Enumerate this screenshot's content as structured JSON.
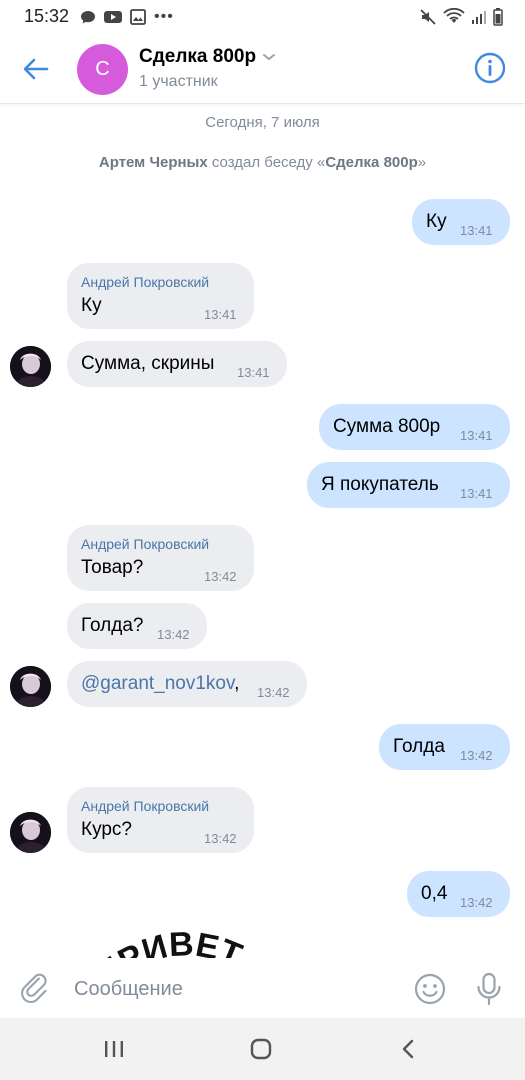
{
  "status_bar": {
    "time": "15:32",
    "left_icons": [
      "chat-bubble-icon",
      "youtube-icon",
      "image-icon",
      "more-dots-icon"
    ],
    "right_icons": [
      "mute-icon",
      "wifi-icon",
      "signal-icon",
      "battery-icon"
    ],
    "dots": "•••"
  },
  "header": {
    "avatar_letter": "С",
    "avatar_color": "#d65bdc",
    "title": "Сделка 800р",
    "subtitle": "1 участник"
  },
  "chat": {
    "date_separator": "Сегодня, 7 июля",
    "system_message": {
      "author": "Артем Черных",
      "action": " создал беседу «",
      "chat_name": "Сделка 800р",
      "closing": "»"
    },
    "messages": [
      {
        "dir": "out",
        "text": "Ку",
        "time": "13:41"
      },
      {
        "dir": "in",
        "author": "Андрей Покровский",
        "text": "Ку",
        "time": "13:41"
      },
      {
        "dir": "in",
        "text": "Сумма, скрины",
        "time": "13:41"
      },
      {
        "dir": "out",
        "text": "Сумма 800р",
        "time": "13:41"
      },
      {
        "dir": "out",
        "text": "Я покупатель",
        "time": "13:41"
      },
      {
        "dir": "in",
        "author": "Андрей Покровский",
        "text": "Товар?",
        "time": "13:42"
      },
      {
        "dir": "in",
        "text": "Голда?",
        "time": "13:42"
      },
      {
        "dir": "in",
        "text": "@garant_nov1kov",
        "text_suffix": ",",
        "time": "13:42"
      },
      {
        "dir": "out",
        "text": "Голда",
        "time": "13:42"
      },
      {
        "dir": "in",
        "author": "Андрей Покровский",
        "text": "Курс?",
        "time": "13:42"
      },
      {
        "dir": "out",
        "text": "0,4",
        "time": "13:42"
      }
    ],
    "sticker_partial_text": "ПРИВЕТ"
  },
  "composer": {
    "placeholder": "Сообщение"
  },
  "colors": {
    "accent": "#3f8ae0",
    "incoming_bubble": "#ebedf0",
    "outgoing_bubble": "#cce4ff",
    "author_name": "#4a76a8",
    "secondary_text": "#818c99"
  }
}
